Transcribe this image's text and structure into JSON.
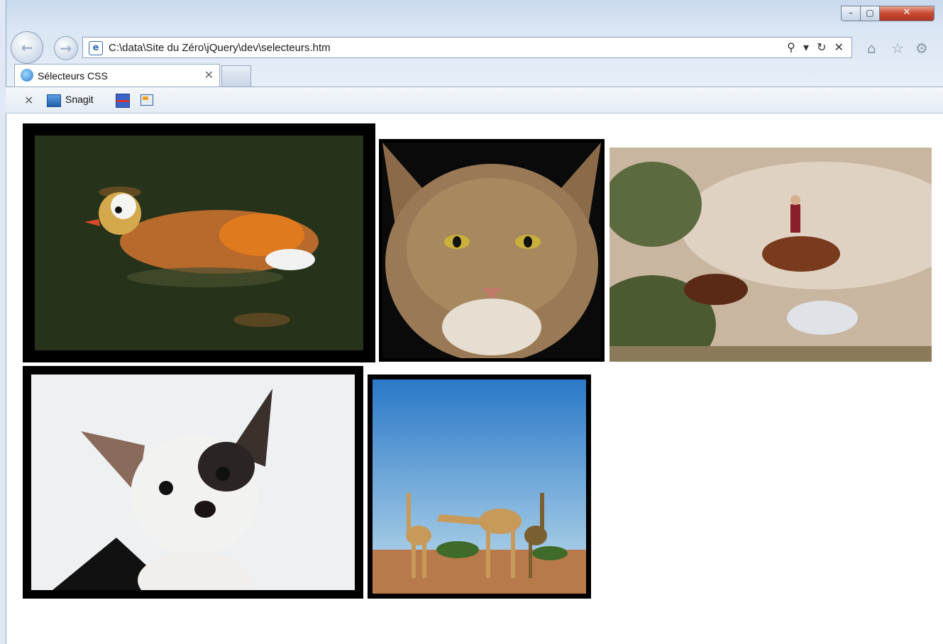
{
  "window": {
    "minimize_glyph": "–",
    "maximize_glyph": "▢",
    "close_glyph": "✕"
  },
  "nav": {
    "back_glyph": "←",
    "forward_glyph": "→"
  },
  "address_bar": {
    "url": "C:\\data\\Site du Zéro\\jQuery\\dev\\selecteurs.htm",
    "tools": "⚲ ▾ ↻ ✕"
  },
  "toolbar_icons": [
    "home-icon",
    "favorites-star-icon",
    "settings-gear-icon"
  ],
  "tab": {
    "label": "Sélecteurs CSS",
    "close_glyph": "✕"
  },
  "command_bar": {
    "close_glyph": "✕",
    "snagit_label": "Snagit"
  },
  "images": [
    {
      "name": "mandarin-duck-image",
      "subject": "duck"
    },
    {
      "name": "tabby-cat-image",
      "subject": "cat"
    },
    {
      "name": "horses-rider-image",
      "subject": "horses"
    },
    {
      "name": "chihuahua-image",
      "subject": "dog"
    },
    {
      "name": "giraffes-image",
      "subject": "giraffes"
    }
  ],
  "colors": {
    "frame_border": "#000000",
    "window_close": "#c74a33",
    "chrome": "#dbe6f4"
  }
}
